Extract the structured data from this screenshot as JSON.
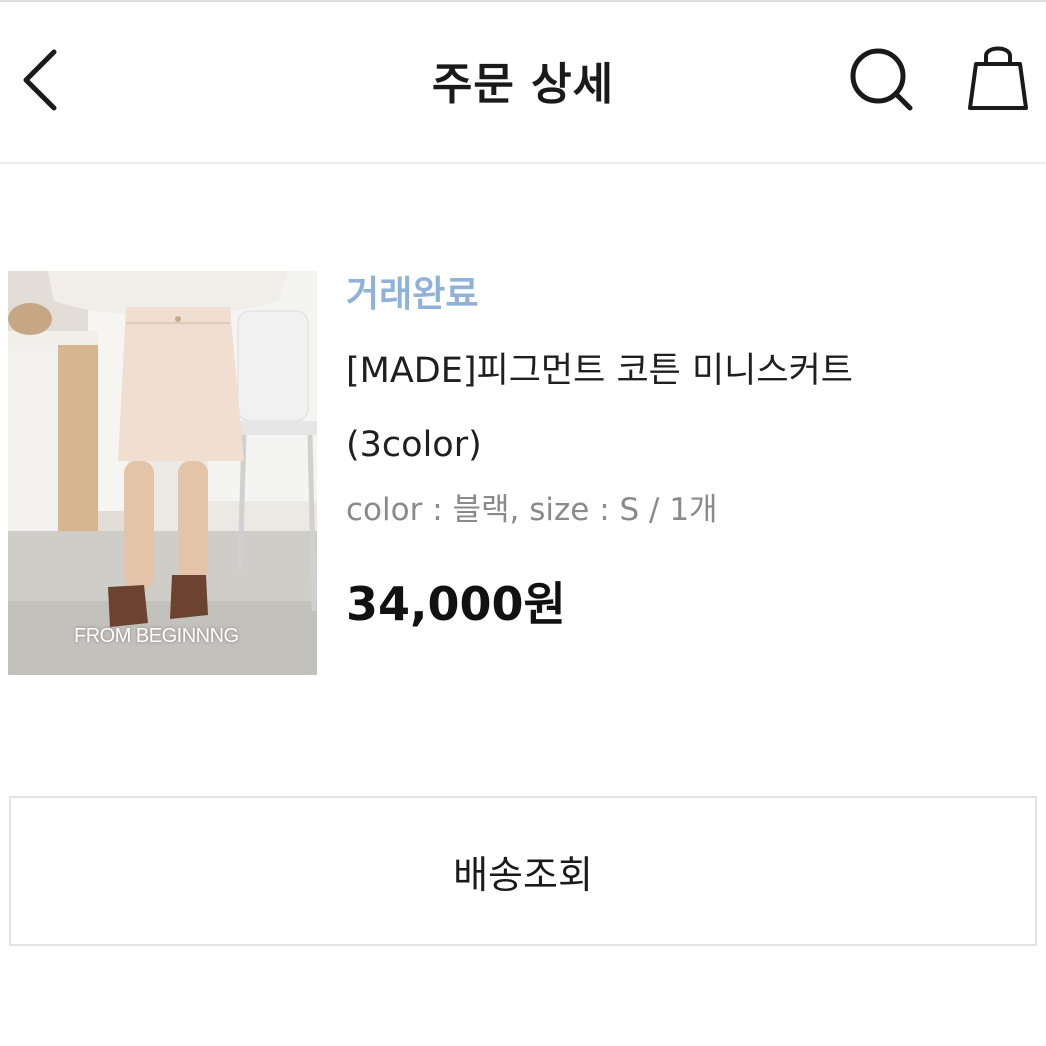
{
  "header": {
    "title": "주문 상세",
    "back_icon": "chevron-left-icon",
    "search_icon": "search-icon",
    "cart_icon": "shopping-bag-icon"
  },
  "order": {
    "status": "거래완료",
    "status_color": "#8fb2da",
    "product": {
      "image_brand_text": "FROM BEGINNNG",
      "name": "[MADE]피그먼트 코튼 미니스커트 (3color)",
      "option": "color : 블랙, size : S / 1개",
      "price": "34,000원"
    }
  },
  "actions": {
    "tracking_label": "배송조회"
  }
}
